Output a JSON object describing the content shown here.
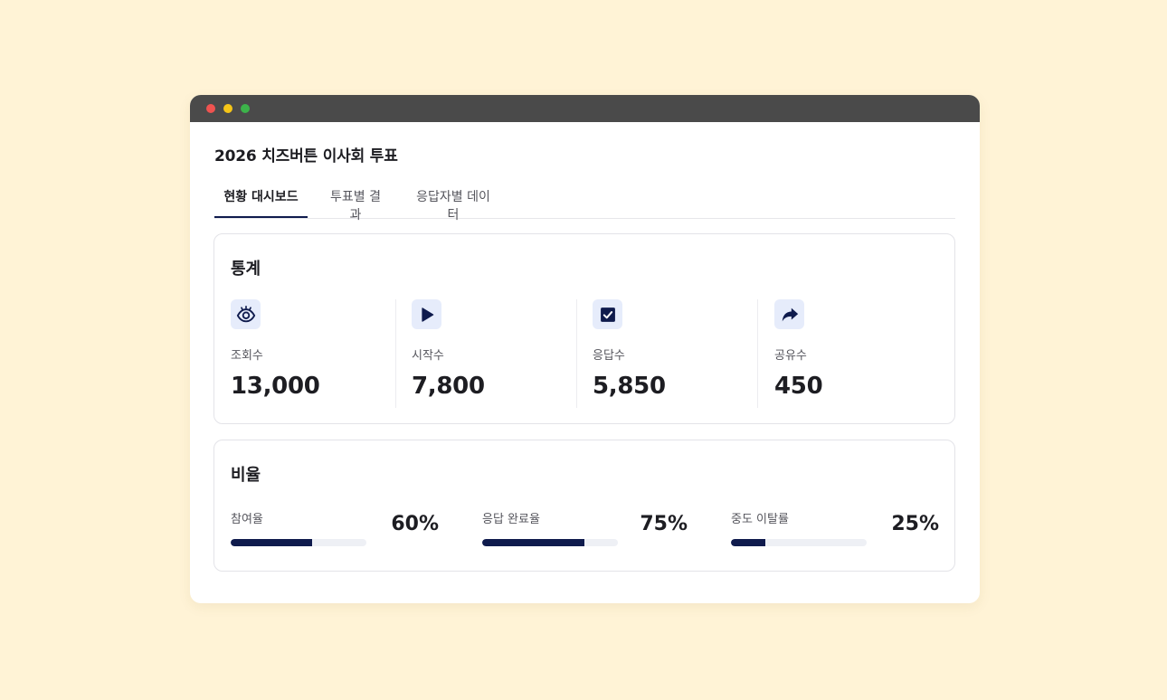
{
  "window": {
    "title": "2026 치즈버튼 이사회 투표"
  },
  "tabs": [
    {
      "label": "현황 대시보드",
      "active": true
    },
    {
      "label": "투표별 결과",
      "active": false
    },
    {
      "label": "응답자별 데이터",
      "active": false
    }
  ],
  "stats": {
    "title": "통계",
    "items": [
      {
        "icon": "eye-icon",
        "label": "조회수",
        "value": "13,000"
      },
      {
        "icon": "play-icon",
        "label": "시작수",
        "value": "7,800"
      },
      {
        "icon": "checkbox-icon",
        "label": "응답수",
        "value": "5,850"
      },
      {
        "icon": "share-icon",
        "label": "공유수",
        "value": "450"
      }
    ]
  },
  "ratios": {
    "title": "비율",
    "items": [
      {
        "label": "참여율",
        "value": "60%",
        "fill": 0.6
      },
      {
        "label": "응답 완료율",
        "value": "75%",
        "fill": 0.75
      },
      {
        "label": "중도 이탈률",
        "value": "25%",
        "fill": 0.25
      }
    ]
  },
  "colors": {
    "accent": "#0f1b4d",
    "icon_bg": "#e6ecfb",
    "page_bg": "#fff3d6",
    "titlebar": "#4a4a4a"
  }
}
